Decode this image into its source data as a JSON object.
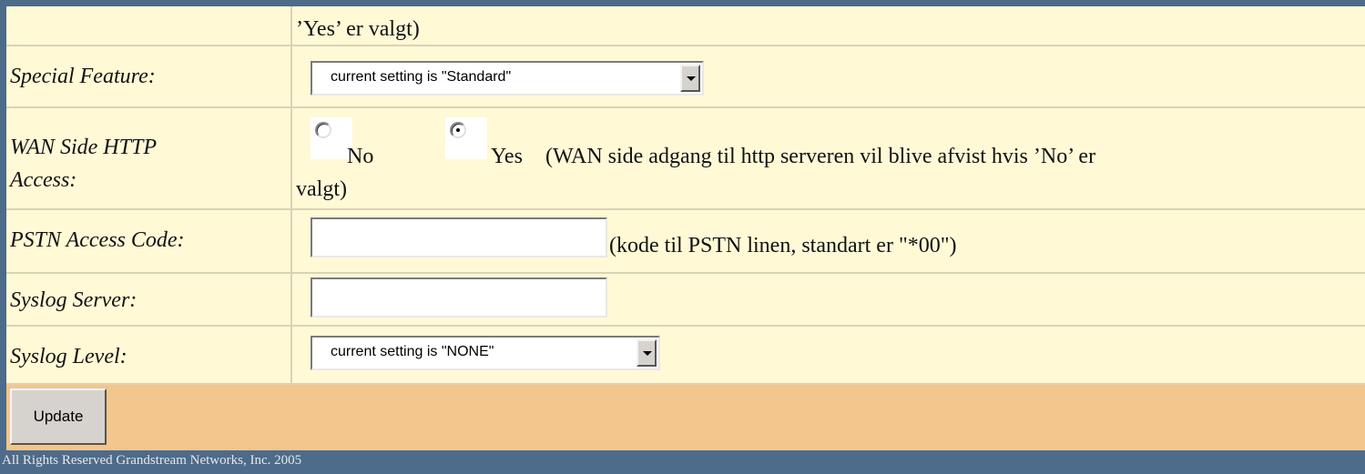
{
  "rows": {
    "continued_text": "’Yes’ er valgt)",
    "special_feature": {
      "label": "Special Feature:",
      "select_value": "current setting is \"Standard\""
    },
    "wan_http": {
      "label_line1": "WAN Side HTTP",
      "label_line2": "Access:",
      "option_no": "No",
      "option_yes": "Yes",
      "selected": "Yes",
      "note_line1": "(WAN side adgang til http serveren vil blive afvist hvis ’No’ er",
      "note_line2": "valgt)"
    },
    "pstn": {
      "label": "PSTN Access Code:",
      "value": "",
      "note": "(kode til PSTN linen, standart er \"*00\")"
    },
    "syslog_server": {
      "label": "Syslog Server:",
      "value": ""
    },
    "syslog_level": {
      "label": "Syslog Level:",
      "select_value": "current setting is \"NONE\""
    }
  },
  "update_button": "Update",
  "footer": "All Rights Reserved Grandstream Networks, Inc. 2005"
}
